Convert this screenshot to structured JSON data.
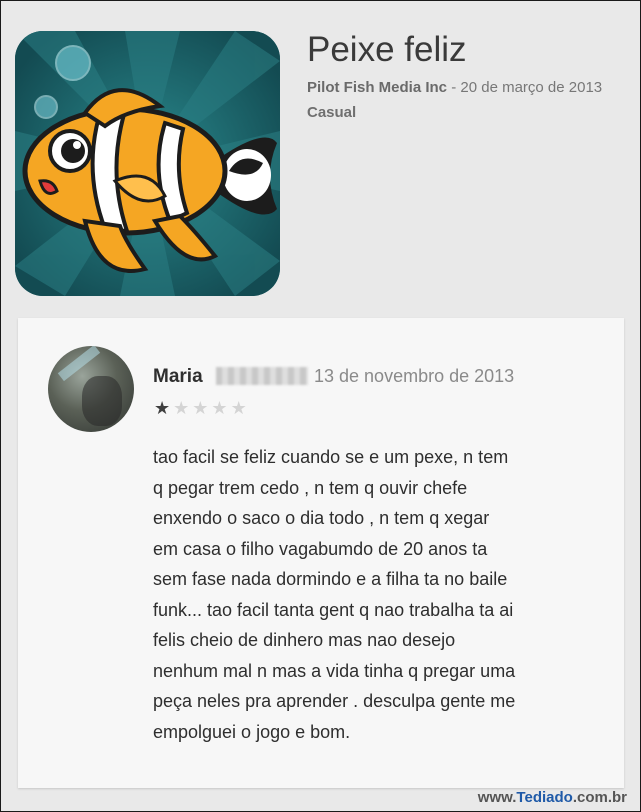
{
  "app": {
    "title": "Peixe feliz",
    "developer": "Pilot Fish Media Inc",
    "meta_separator": " - ",
    "release_date": "20 de março de 2013",
    "category": "Casual",
    "icon": "clownfish-app-icon"
  },
  "review": {
    "reviewer_name": "Maria",
    "date": "13 de novembro de 2013",
    "rating": 1,
    "max_rating": 5,
    "text": "tao facil se feliz cuando se e um pexe, n tem\nq pegar trem cedo , n tem q ouvir chefe\nenxendo o saco o dia todo , n tem q xegar\nem casa o filho vagabumdo de 20 anos ta\nsem fase nada dormindo e a filha ta no baile\nfunk... tao facil tanta gent q nao trabalha ta ai\nfelis cheio de dinhero mas nao desejo\nnenhum mal n mas a vida tinha q pregar uma\npeça neles pra aprender . desculpa gente me\nempolguei o jogo e bom."
  },
  "watermark": {
    "prefix": "www.",
    "brand": "Tediado",
    "suffix": ".com.br"
  },
  "colors": {
    "icon_background": "#1f6c72",
    "fish_orange": "#f5a623",
    "background": "#e9e9e9",
    "card": "#f7f7f7"
  }
}
